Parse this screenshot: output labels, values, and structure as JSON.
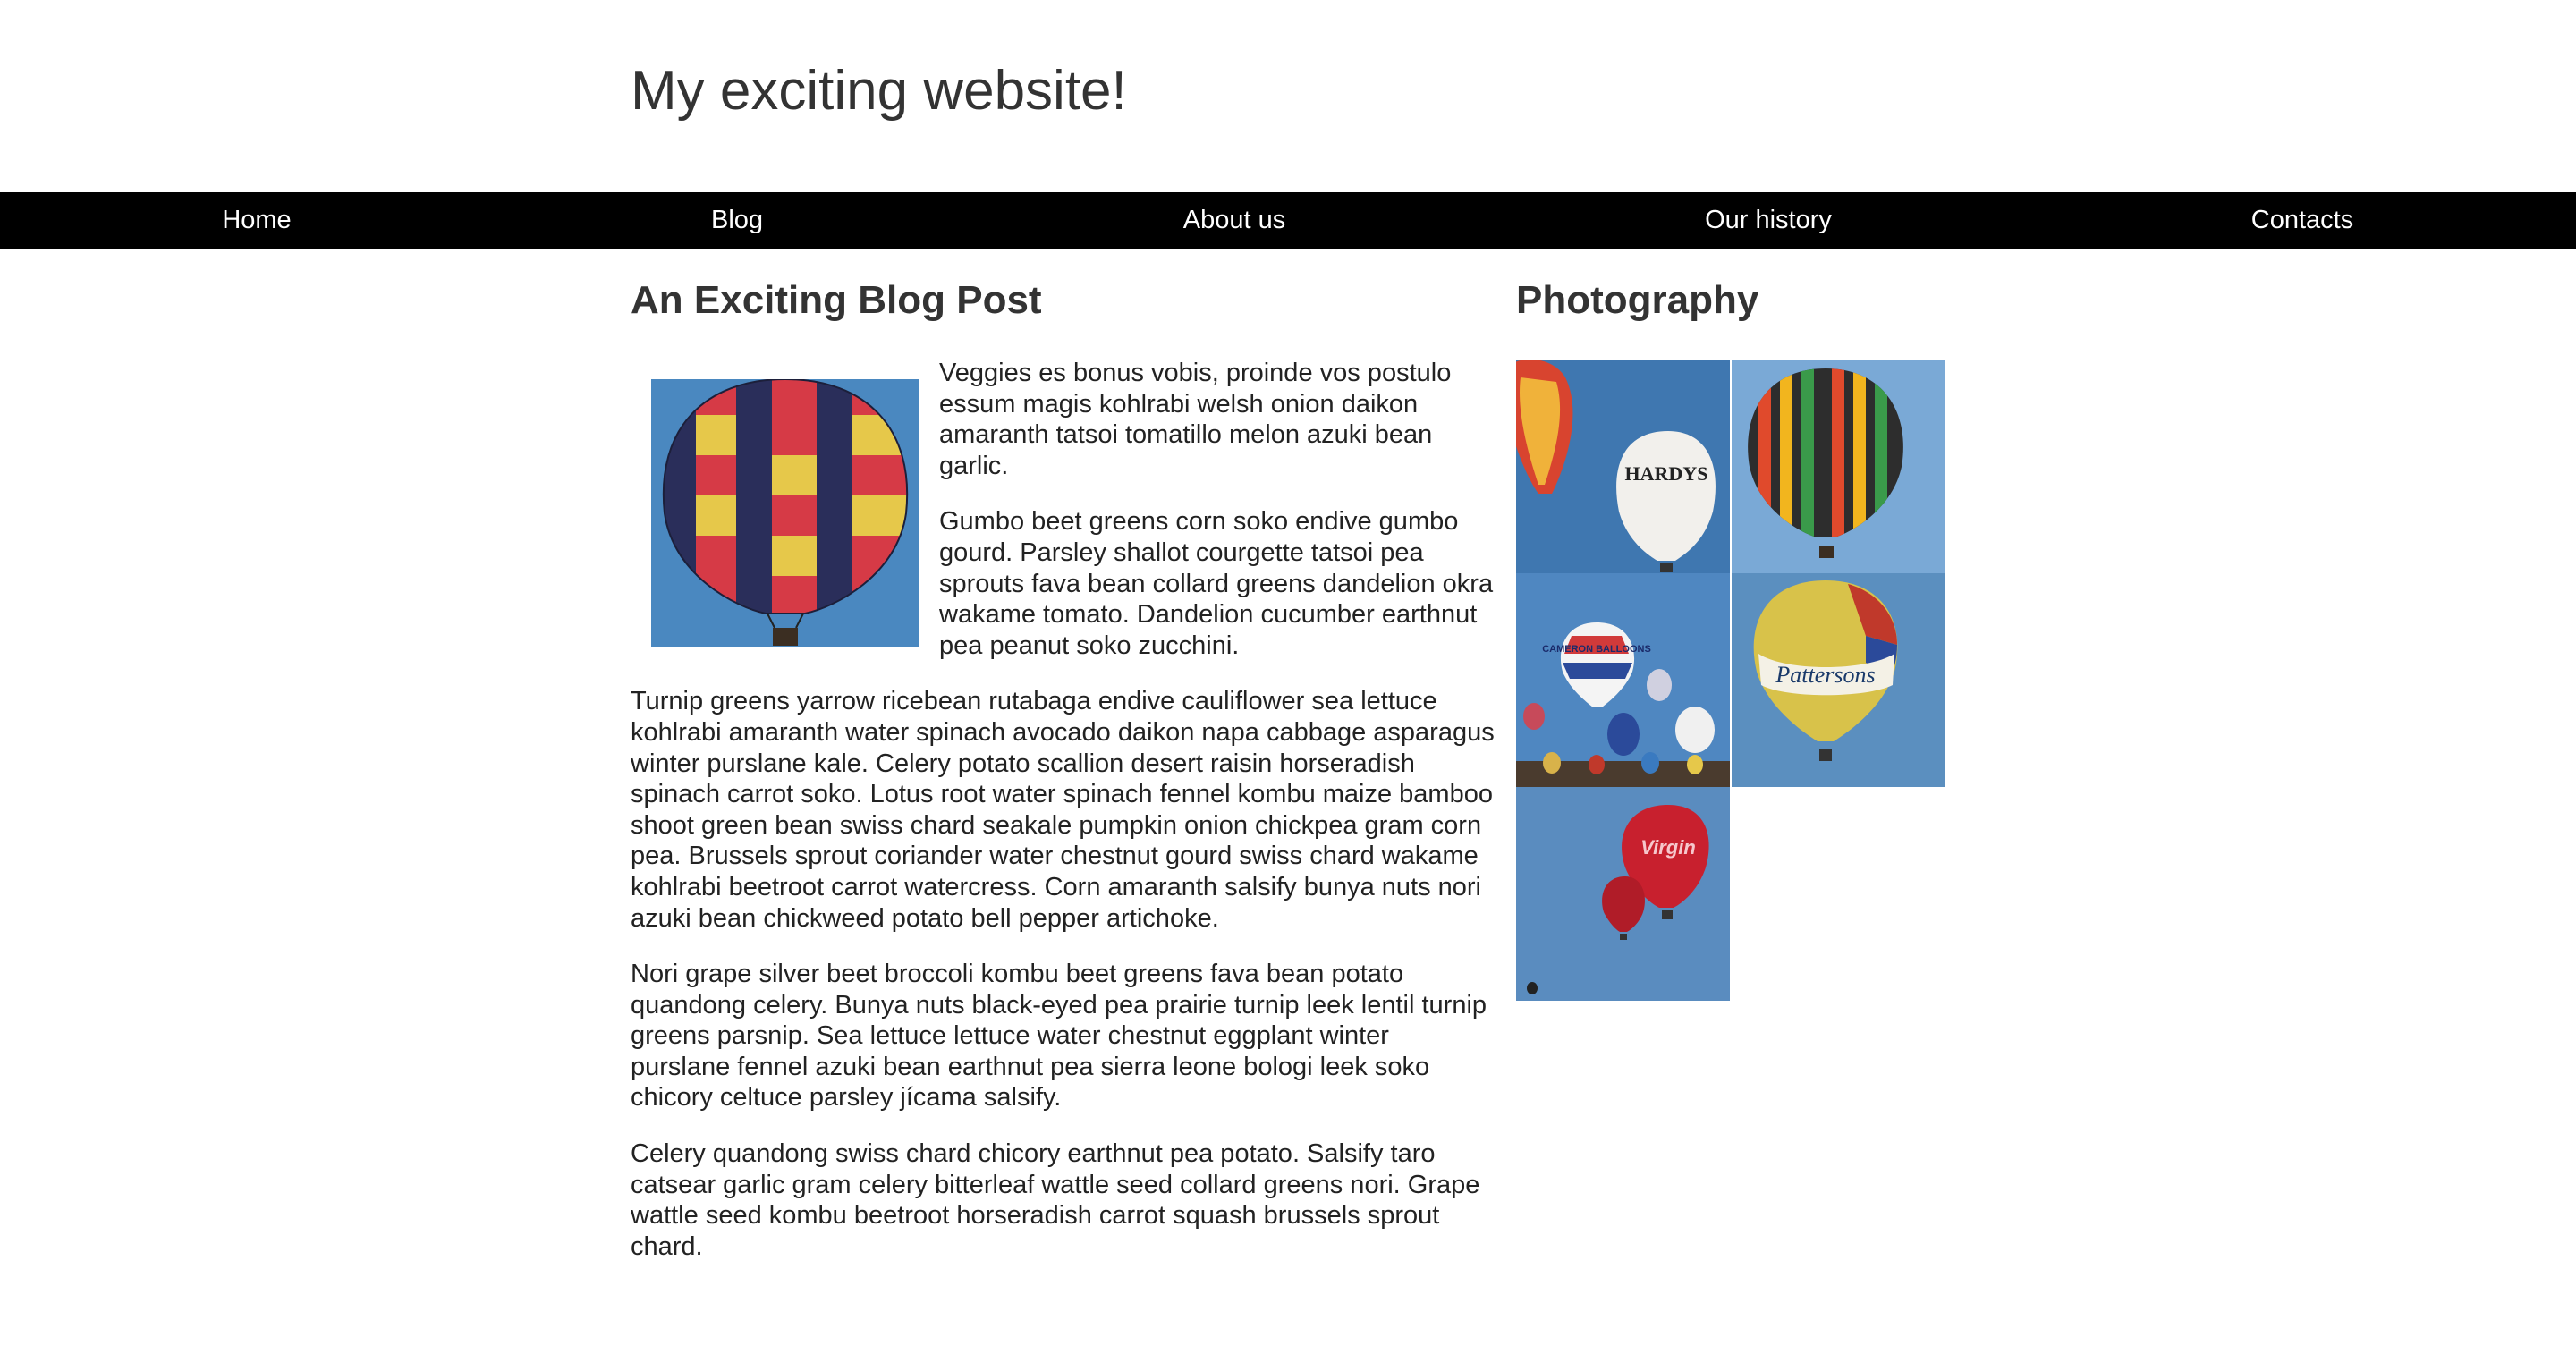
{
  "site": {
    "title": "My exciting website!"
  },
  "nav": {
    "items": [
      {
        "label": "Home"
      },
      {
        "label": "Blog"
      },
      {
        "label": "About us"
      },
      {
        "label": "Our history"
      },
      {
        "label": "Contacts"
      }
    ]
  },
  "post": {
    "title": "An Exciting Blog Post",
    "featured_image_icon": "hot-air-balloon-icon",
    "paragraphs": [
      "Veggies es bonus vobis, proinde vos postulo essum magis kohlrabi welsh onion daikon amaranth tatsoi tomatillo melon azuki bean garlic.",
      "Gumbo beet greens corn soko endive gumbo gourd. Parsley shallot courgette tatsoi pea sprouts fava bean collard greens dandelion okra wakame tomato. Dandelion cucumber earthnut pea peanut soko zucchini.",
      "Turnip greens yarrow ricebean rutabaga endive cauliflower sea lettuce kohlrabi amaranth water spinach avocado daikon napa cabbage asparagus winter purslane kale. Celery potato scallion desert raisin horseradish spinach carrot soko. Lotus root water spinach fennel kombu maize bamboo shoot green bean swiss chard seakale pumpkin onion chickpea gram corn pea. Brussels sprout coriander water chestnut gourd swiss chard wakame kohlrabi beetroot carrot watercress. Corn amaranth salsify bunya nuts nori azuki bean chickweed potato bell pepper artichoke.",
      "Nori grape silver beet broccoli kombu beet greens fava bean potato quandong celery. Bunya nuts black-eyed pea prairie turnip leek lentil turnip greens parsnip. Sea lettuce lettuce water chestnut eggplant winter purslane fennel azuki bean earthnut pea sierra leone bologi leek soko chicory celtuce parsley jícama salsify.",
      "Celery quandong swiss chard chicory earthnut pea potato. Salsify taro catsear garlic gram celery bitterleaf wattle seed collard greens nori. Grape wattle seed kombu beetroot horseradish carrot squash brussels sprout chard."
    ]
  },
  "photography": {
    "title": "Photography",
    "photos": [
      {
        "icon": "hot-air-balloon-icon",
        "balloon_text": "HARDYS"
      },
      {
        "icon": "hot-air-balloon-icon",
        "balloon_text": ""
      },
      {
        "icon": "hot-air-balloon-icon",
        "balloon_text": "CAMERON BALLOONS"
      },
      {
        "icon": "hot-air-balloon-icon",
        "balloon_text": "Pattersons"
      },
      {
        "icon": "hot-air-balloon-icon",
        "balloon_text": "Virgin"
      }
    ]
  },
  "colors": {
    "nav_background": "#000000",
    "nav_text": "#ffffff",
    "text": "#333333",
    "sky_blue": "#4a88c0"
  }
}
